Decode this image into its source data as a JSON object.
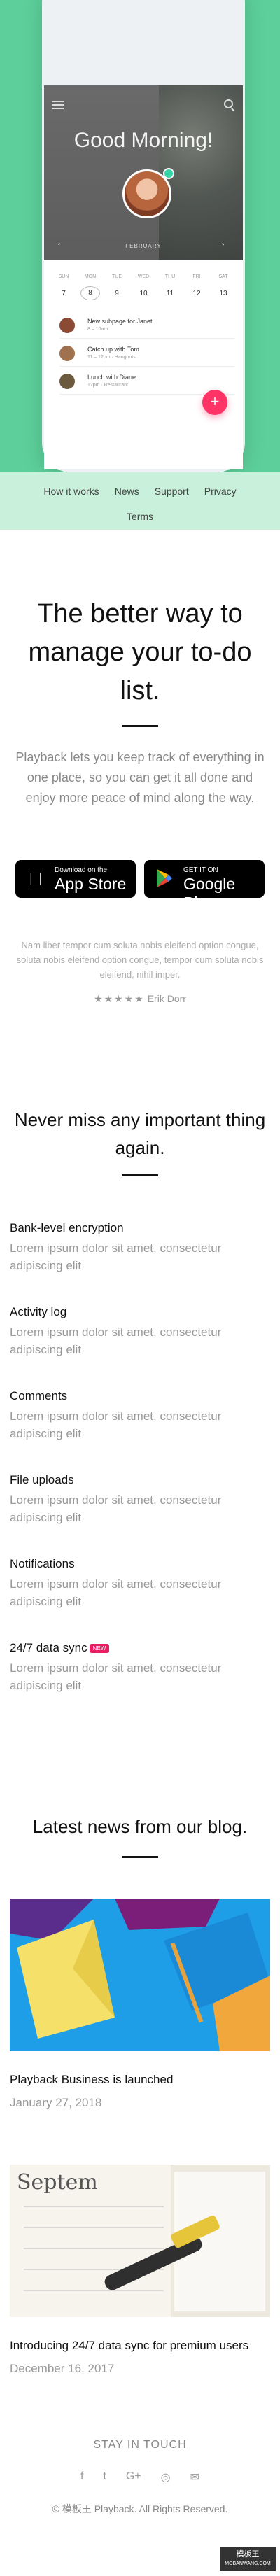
{
  "app": {
    "greeting": "Good Morning!",
    "month": "FEBRUARY",
    "days": [
      "SUN",
      "MON",
      "TUE",
      "WED",
      "THU",
      "FRI",
      "SAT"
    ],
    "dates": [
      "7",
      "8",
      "9",
      "10",
      "11",
      "12",
      "13"
    ],
    "tasks": [
      {
        "title": "New subpage for Janet",
        "sub": "8 – 10am"
      },
      {
        "title": "Catch up with Tom",
        "sub": "11 – 12pm · Hangouts"
      },
      {
        "title": "Lunch with Diane",
        "sub": "12pm · Restaurant"
      }
    ],
    "fab": "+"
  },
  "nav": {
    "row1": [
      "How it works",
      "News",
      "Support",
      "Privacy"
    ],
    "row2": [
      "Terms"
    ]
  },
  "intro": {
    "headline": "The better way to manage your to-do list.",
    "lead": "Playback lets you keep track of everything in one place, so you can get it all done and enjoy more peace of mind along the way."
  },
  "stores": {
    "apple_small": "Download on the",
    "apple_large": "App Store",
    "google_small": "GET IT ON",
    "google_large": "Google Play"
  },
  "testimonial": {
    "quote": "Nam liber tempor cum soluta nobis eleifend option congue, soluta nobis eleifend option congue, tempor cum soluta nobis eleifend, nihil imper.",
    "stars": "★★★★★",
    "author": "Erik Dorr"
  },
  "features": {
    "heading": "Never miss any important thing again.",
    "items": [
      {
        "title": "Bank-level encryption",
        "desc": "Lorem ipsum dolor sit amet, consectetur adipiscing elit"
      },
      {
        "title": "Activity log",
        "desc": "Lorem ipsum dolor sit amet, consectetur adipiscing elit"
      },
      {
        "title": "Comments",
        "desc": "Lorem ipsum dolor sit amet, consectetur adipiscing elit"
      },
      {
        "title": "File uploads",
        "desc": "Lorem ipsum dolor sit amet, consectetur adipiscing elit"
      },
      {
        "title": "Notifications",
        "desc": "Lorem ipsum dolor sit amet, consectetur adipiscing elit"
      },
      {
        "title": "24/7 data sync",
        "desc": "Lorem ipsum dolor sit amet, consectetur adipiscing elit",
        "badge": "NEW"
      }
    ]
  },
  "news": {
    "heading": "Latest news from our blog.",
    "posts": [
      {
        "title": "Playback Business is launched",
        "date": "January 27, 2018"
      },
      {
        "title": "Introducing 24/7 data sync for premium users",
        "date": "December 16, 2017"
      }
    ]
  },
  "footer": {
    "stay": "STAY IN TOUCH",
    "social": [
      "f",
      "t",
      "G+",
      "◎",
      "✉"
    ],
    "copyright": "© 模板王 Playback. All Rights Reserved.",
    "watermark_top": "模板王",
    "watermark_bottom": "MOBANWANG.COM"
  },
  "colors": {
    "hero": "#5ccf9a",
    "nav": "#c9f0da",
    "accent": "#ff3366",
    "badge": "#e91e63"
  }
}
